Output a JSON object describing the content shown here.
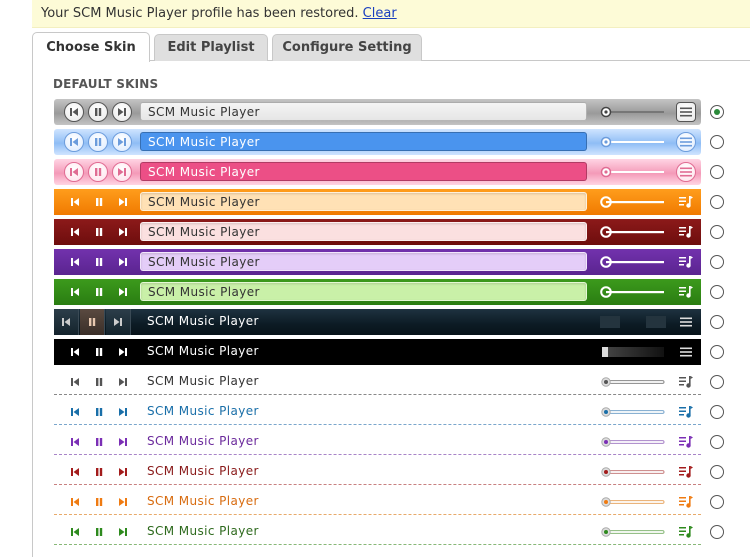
{
  "notice": {
    "text": "Your SCM Music Player profile has been restored.",
    "link": "Clear"
  },
  "tabs": [
    {
      "label": "Choose Skin",
      "active": true
    },
    {
      "label": "Edit Playlist",
      "active": false
    },
    {
      "label": "Configure Setting",
      "active": false
    }
  ],
  "section_title": "DEFAULT SKINS",
  "player_title": "SCM Music Player",
  "skins": [
    {
      "name": "gray",
      "style": "glossy",
      "bar": "#9a9a9a",
      "bar2": "#c4c4c4",
      "btn": "#e8e8e8",
      "glyph": "#555555",
      "box": "#e6e6e6",
      "text": "#333333",
      "selected": true
    },
    {
      "name": "blue",
      "style": "glossy",
      "bar": "#8fbdf5",
      "bar2": "#cfe4ff",
      "btn": "#dbeaff",
      "glyph": "#6c9cdc",
      "box": "#4a94ee",
      "text": "#ffffff",
      "selected": false
    },
    {
      "name": "pink",
      "style": "glossy",
      "bar": "#f49ab8",
      "bar2": "#ffd4e3",
      "btn": "#ffe0ea",
      "glyph": "#e06c93",
      "box": "#ec4f86",
      "text": "#ffffff",
      "selected": false
    },
    {
      "name": "orange",
      "style": "flat",
      "bar": "#f07a00",
      "bar2": "#ff9d1c",
      "glyph": "#ffffff",
      "box": "#ffe1b5",
      "text": "#333333",
      "selected": false
    },
    {
      "name": "maroon",
      "style": "flat",
      "bar": "#6e0d0d",
      "bar2": "#8c1a1a",
      "glyph": "#ffffff",
      "box": "#fbe0e0",
      "text": "#333333",
      "selected": false
    },
    {
      "name": "purple",
      "style": "flat",
      "bar": "#5a2490",
      "bar2": "#7232ad",
      "glyph": "#ffffff",
      "box": "#e4cdf8",
      "text": "#333333",
      "selected": false
    },
    {
      "name": "green",
      "style": "flat",
      "bar": "#2a7d12",
      "bar2": "#3c9a1c",
      "glyph": "#ffffff",
      "box": "#c9f0a8",
      "text": "#333333",
      "selected": false
    },
    {
      "name": "dark-glass",
      "style": "dark",
      "bar": "#0c1b24",
      "bar2": "#1e3240",
      "glyph": "#cccccc",
      "box": "transparent",
      "text": "#ffffff",
      "selected": false
    },
    {
      "name": "black",
      "style": "black",
      "bar": "#000000",
      "bar2": "#111111",
      "glyph": "#ffffff",
      "box": "transparent",
      "text": "#ffffff",
      "selected": false
    },
    {
      "name": "minimal-gray",
      "style": "minimal",
      "bar": "#ffffff",
      "accent": "#555555",
      "text": "#333333",
      "line": "#888888",
      "selected": false
    },
    {
      "name": "minimal-blue",
      "style": "minimal",
      "bar": "#ffffff",
      "accent": "#1a6fa8",
      "text": "#1a6fa8",
      "line": "#7aa6cc",
      "selected": false
    },
    {
      "name": "minimal-purple",
      "style": "minimal",
      "bar": "#ffffff",
      "accent": "#7b2fb5",
      "text": "#6b2a9c",
      "line": "#a884c8",
      "selected": false
    },
    {
      "name": "minimal-red",
      "style": "minimal",
      "bar": "#ffffff",
      "accent": "#a31c1c",
      "text": "#8a1a1a",
      "line": "#c88080",
      "selected": false
    },
    {
      "name": "minimal-orange",
      "style": "minimal",
      "bar": "#ffffff",
      "accent": "#ef7b12",
      "text": "#d86c10",
      "line": "#e8aa6a",
      "selected": false
    },
    {
      "name": "minimal-green",
      "style": "minimal",
      "bar": "#ffffff",
      "accent": "#2e8a1e",
      "text": "#2e6a1e",
      "line": "#88b878",
      "selected": false
    }
  ]
}
